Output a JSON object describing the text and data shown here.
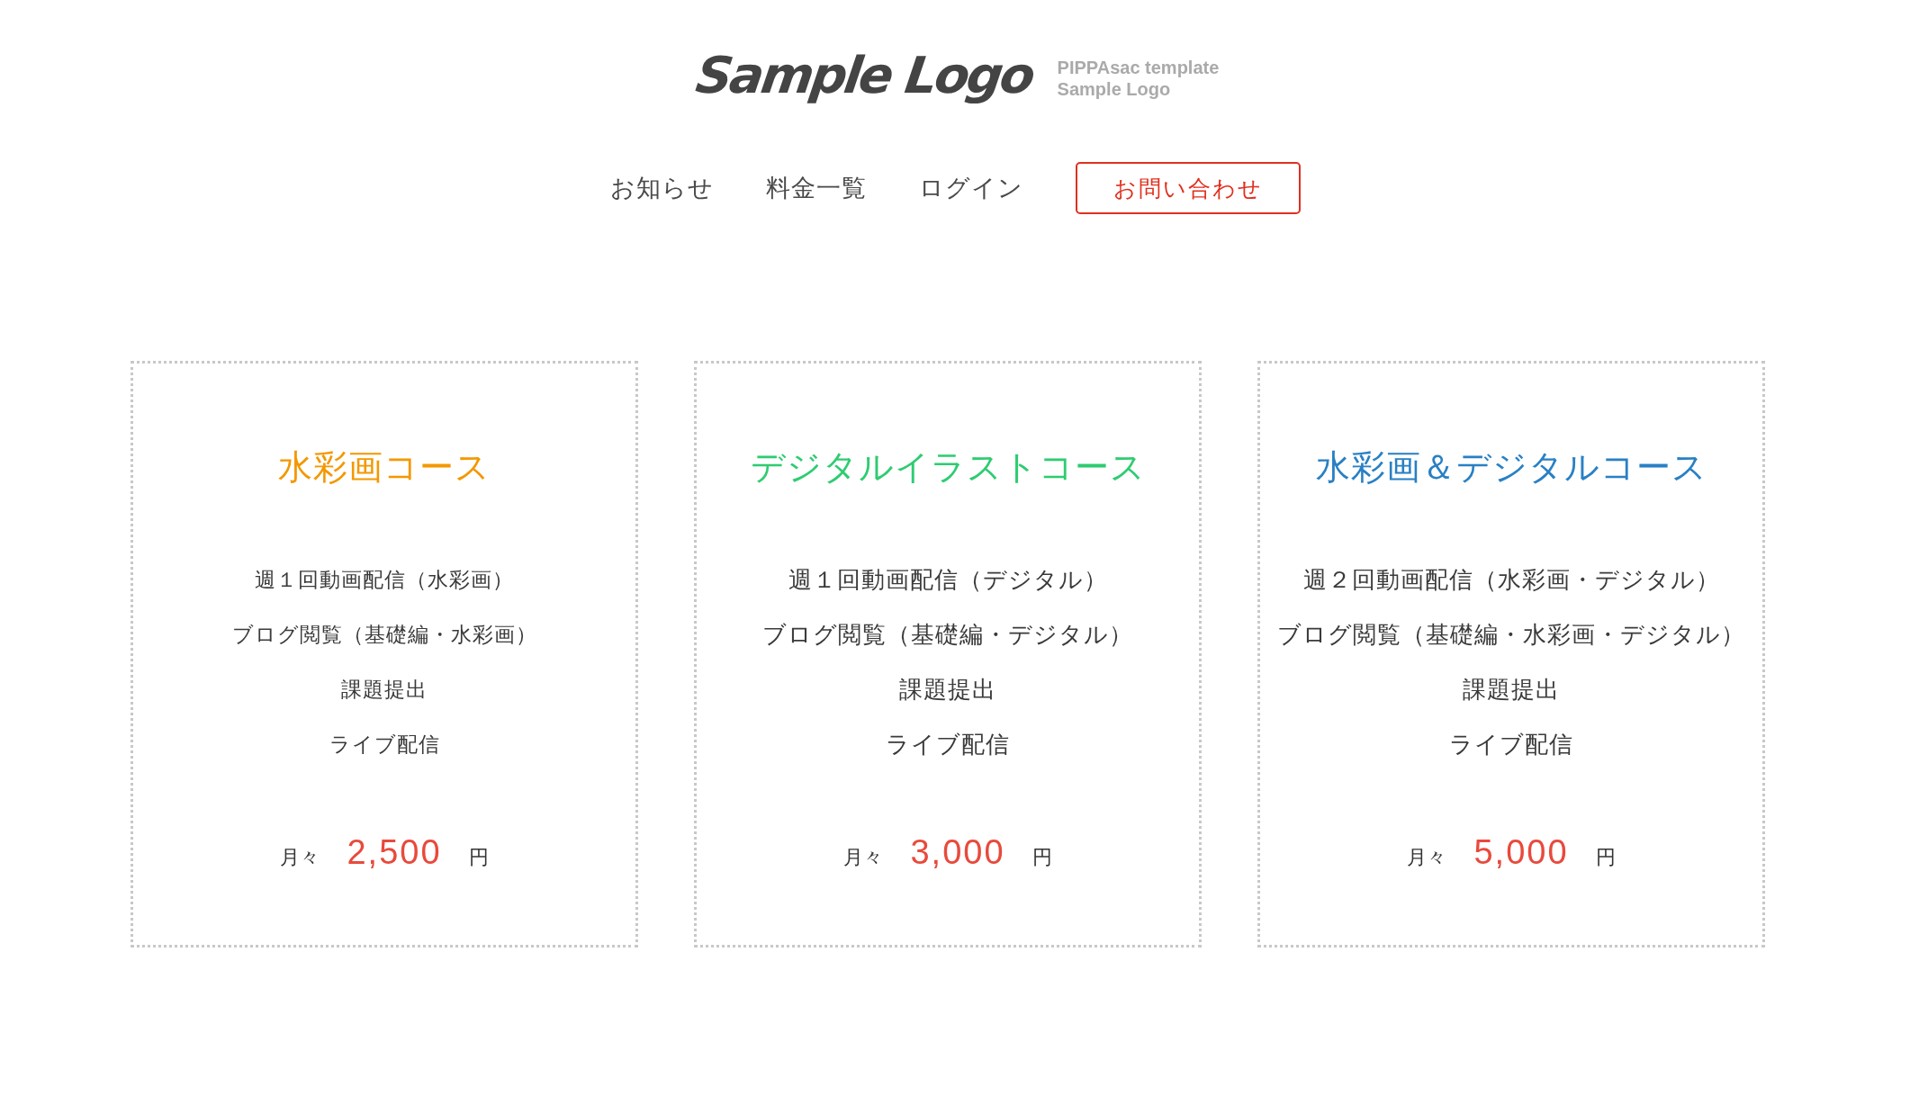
{
  "header": {
    "logo": {
      "text": "Sample Logo",
      "tagline": [
        "PIPPAsac template",
        "Sample Logo"
      ]
    },
    "nav": [
      {
        "label": "お知らせ",
        "kind": "link"
      },
      {
        "label": "料金一覧",
        "kind": "link"
      },
      {
        "label": "ログイン",
        "kind": "link"
      },
      {
        "label": "お問い合わせ",
        "kind": "button"
      }
    ]
  },
  "plans": [
    {
      "title": "水彩画コース",
      "color": "#f39800",
      "features": [
        "週１回動画配信（水彩画）",
        "ブログ閲覧（基礎編・水彩画）",
        "課題提出",
        "ライブ配信"
      ],
      "price": {
        "prefix": "月々",
        "amount": "2,500",
        "unit": "円"
      }
    },
    {
      "title": "デジタルイラストコース",
      "color": "#2ecc71",
      "features": [
        "週１回動画配信（デジタル）",
        "ブログ閲覧（基礎編・デジタル）",
        "課題提出",
        "ライブ配信"
      ],
      "price": {
        "prefix": "月々",
        "amount": "3,000",
        "unit": "円"
      }
    },
    {
      "title": "水彩画＆デジタルコース",
      "color": "#2980c4",
      "features": [
        "週２回動画配信（水彩画・デジタル）",
        "ブログ閲覧（基礎編・水彩画・デジタル）",
        "課題提出",
        "ライブ配信"
      ],
      "price": {
        "prefix": "月々",
        "amount": "5,000",
        "unit": "円"
      }
    }
  ]
}
